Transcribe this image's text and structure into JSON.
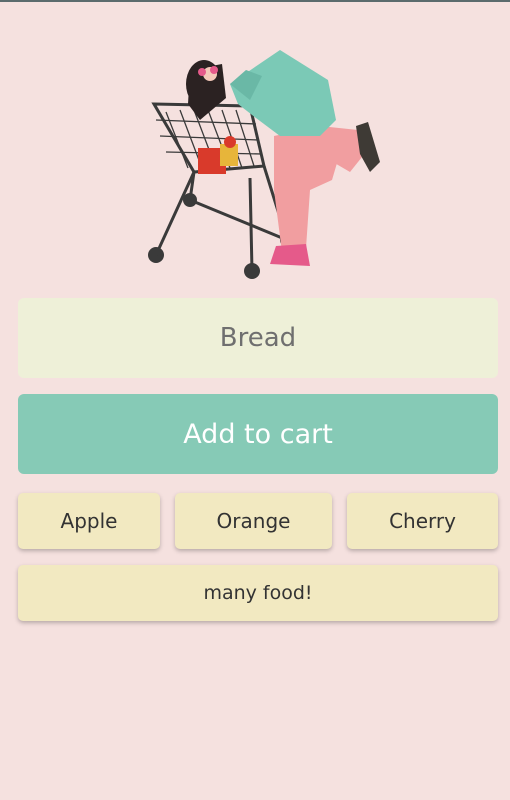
{
  "input": {
    "value": "Bread"
  },
  "buttons": {
    "add_to_cart": "Add to cart",
    "apple": "Apple",
    "orange": "Orange",
    "cherry": "Cherry",
    "many_food": "many food!"
  },
  "colors": {
    "background": "#f5e1df",
    "input_bg": "#eef0d8",
    "add_button": "#86cab6",
    "food_button": "#f2e9c1"
  },
  "illustration": {
    "icon": "shopping-cart-girl-illustration"
  }
}
